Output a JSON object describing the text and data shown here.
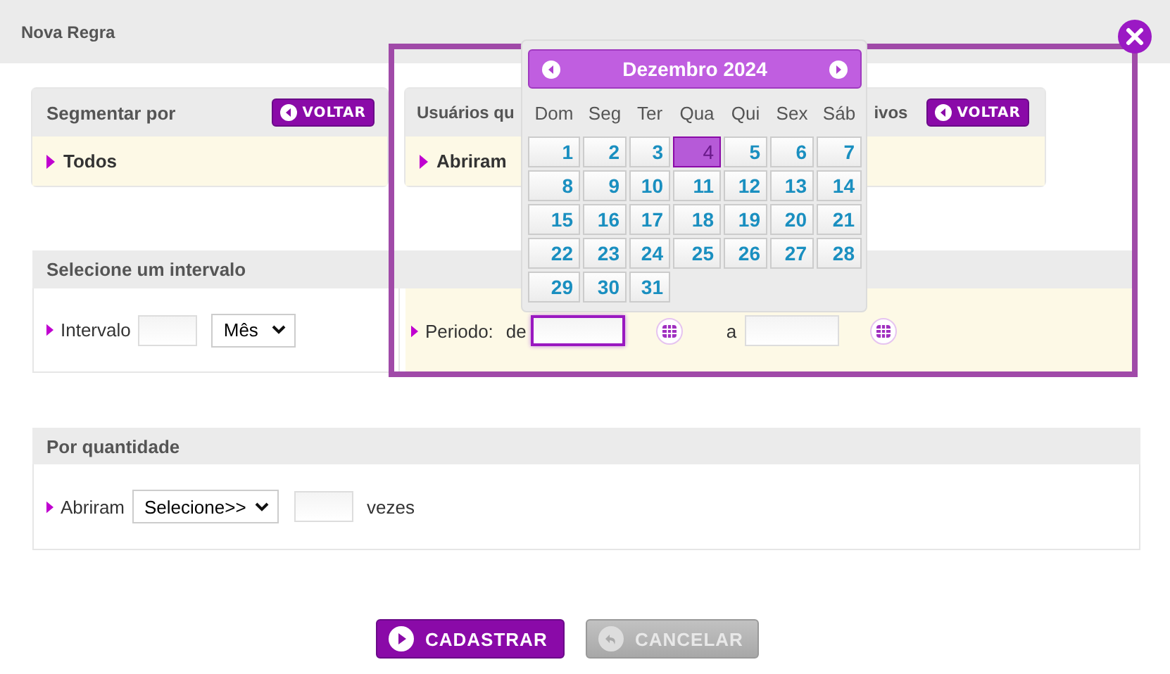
{
  "dialog": {
    "title": "Nova Regra"
  },
  "segment_panel": {
    "title": "Segmentar por",
    "back_button": "VOLTAR",
    "item": "Todos"
  },
  "users_panel": {
    "title_start": "Usuários qu",
    "title_end": "ivos",
    "back_button": "VOLTAR",
    "item": "Abriram"
  },
  "interval_section": {
    "title": "Selecione um intervalo",
    "interval_label": "Intervalo",
    "unit_select": "Mês",
    "period_label": "Periodo:",
    "from_label": "de",
    "from_focused": true,
    "to_label": "a"
  },
  "quantity_section": {
    "title": "Por quantidade",
    "label": "Abriram",
    "select": "Selecione>>",
    "suffix": "vezes"
  },
  "buttons": [
    {
      "label": "CADASTRAR",
      "disabled": false
    },
    {
      "label": "CANCELAR",
      "disabled": true
    }
  ],
  "calendar": {
    "month": "Dezembro 2024",
    "weekdays": [
      "Dom",
      "Seg",
      "Ter",
      "Qua",
      "Qui",
      "Sex",
      "Sáb"
    ],
    "days": [
      {
        "label": "1",
        "selected": false
      },
      {
        "label": "2",
        "selected": false
      },
      {
        "label": "3",
        "selected": false
      },
      {
        "label": "4",
        "selected": true
      },
      {
        "label": "5",
        "selected": false
      },
      {
        "label": "6",
        "selected": false
      },
      {
        "label": "7",
        "selected": false
      },
      {
        "label": "8",
        "selected": false
      },
      {
        "label": "9",
        "selected": false
      },
      {
        "label": "10",
        "selected": false
      },
      {
        "label": "11",
        "selected": false
      },
      {
        "label": "12",
        "selected": false
      },
      {
        "label": "13",
        "selected": false
      },
      {
        "label": "14",
        "selected": false
      },
      {
        "label": "15",
        "selected": false
      },
      {
        "label": "16",
        "selected": false
      },
      {
        "label": "17",
        "selected": false
      },
      {
        "label": "18",
        "selected": false
      },
      {
        "label": "19",
        "selected": false
      },
      {
        "label": "20",
        "selected": false
      },
      {
        "label": "21",
        "selected": false
      },
      {
        "label": "22",
        "selected": false
      },
      {
        "label": "23",
        "selected": false
      },
      {
        "label": "24",
        "selected": false
      },
      {
        "label": "25",
        "selected": false
      },
      {
        "label": "26",
        "selected": false
      },
      {
        "label": "27",
        "selected": false
      },
      {
        "label": "28",
        "selected": false
      },
      {
        "label": "29",
        "selected": false
      },
      {
        "label": "30",
        "selected": false
      },
      {
        "label": "31",
        "selected": false
      }
    ]
  }
}
